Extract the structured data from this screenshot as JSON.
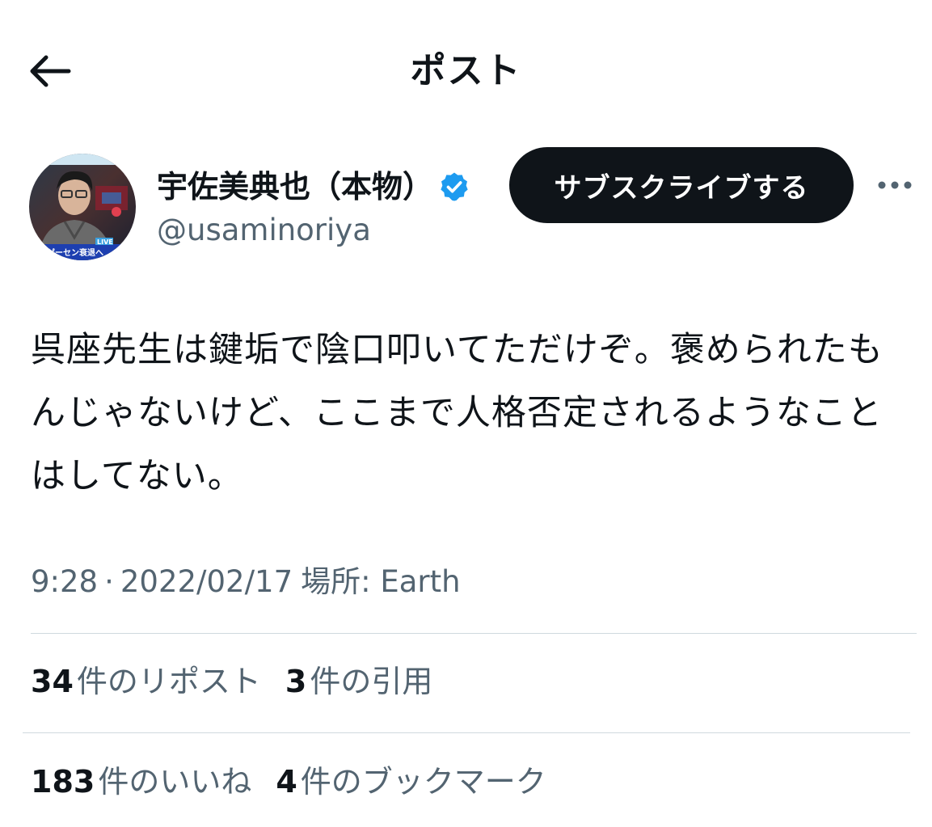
{
  "header": {
    "title": "ポスト",
    "back_icon": "arrow-left-icon"
  },
  "author": {
    "display_name": "宇佐美典也（本物）",
    "handle": "@usaminoriya",
    "verified": true,
    "verified_color": "#1d9bf0",
    "avatar_overlay_text": "LIVE",
    "avatar_caption": "ゲーセン衰退へ"
  },
  "subscribe_button": {
    "label": "サブスクライブする",
    "color": "#0f1419"
  },
  "tweet": {
    "text": "呉座先生は鍵垢で陰口叩いてただけぞ。褒められたもんじゃないけど、ここまで人格否定されるようなことはしてない。"
  },
  "meta": {
    "time": "9:28",
    "separator": "·",
    "date": "2022/02/17",
    "location_label": "場所: Earth"
  },
  "stats": {
    "reposts": {
      "count": "34",
      "label": "件のリポスト"
    },
    "quotes": {
      "count": "3",
      "label": "件の引用"
    },
    "likes": {
      "count": "183",
      "label": "件のいいね"
    },
    "bookmarks": {
      "count": "4",
      "label": "件のブックマーク"
    }
  },
  "colors": {
    "text_primary": "#0f1419",
    "text_secondary": "#536471",
    "divider": "#cfd9de"
  }
}
